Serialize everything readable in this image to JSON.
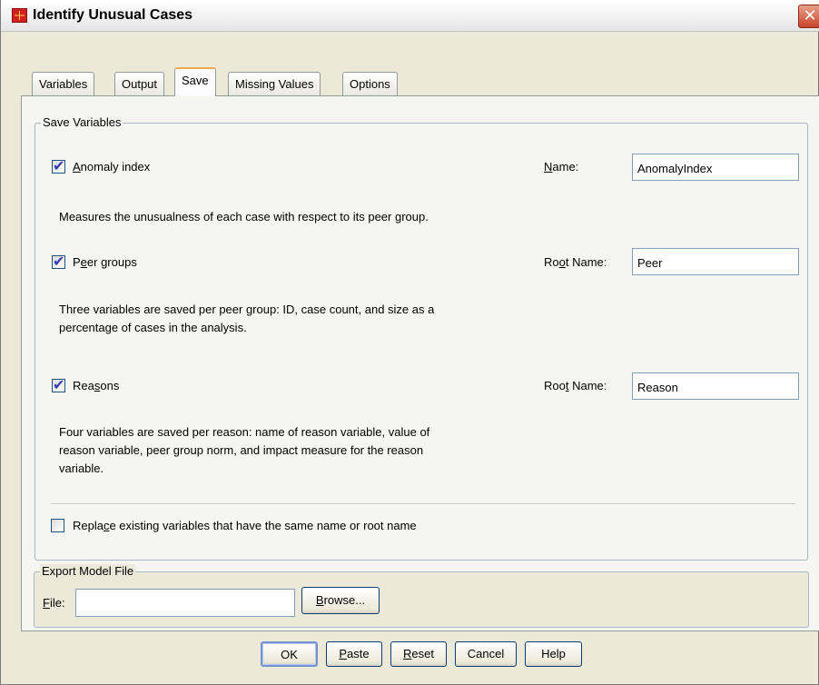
{
  "window": {
    "title": "Identify Unusual Cases",
    "close_glyph": "✕",
    "icon": "spss-data-editor-icon"
  },
  "tabs": [
    {
      "label": "Variables",
      "active": false
    },
    {
      "label": "Output",
      "active": false
    },
    {
      "label": "Save",
      "active": true
    },
    {
      "label": "Missing Values",
      "active": false
    },
    {
      "label": "Options",
      "active": false
    }
  ],
  "save_variables": {
    "legend": "Save Variables",
    "anomaly": {
      "pre": "",
      "mnemonic": "A",
      "post": "nomaly index",
      "checked": true,
      "field_label_pre": "",
      "field_label_mnemonic": "N",
      "field_label_post": "ame:",
      "value": "AnomalyIndex",
      "description": "Measures the unusualness of each case with respect to its peer group."
    },
    "peer": {
      "pre": "P",
      "mnemonic": "e",
      "post": "er groups",
      "checked": true,
      "field_label_pre": "Ro",
      "field_label_mnemonic": "o",
      "field_label_post": "t Name:",
      "value": "Peer",
      "description_line1": "Three variables are saved per peer group: ID, case count, and size as a",
      "description_line2": "percentage of cases in the analysis."
    },
    "reasons": {
      "pre": "Rea",
      "mnemonic": "s",
      "post": "ons",
      "checked": true,
      "field_label_pre": "Roo",
      "field_label_mnemonic": "t",
      "field_label_post": " Name:",
      "value": "Reason",
      "description_line1": "Four variables are saved per reason: name of reason variable, value of",
      "description_line2": "reason variable, peer group norm, and impact measure for the reason",
      "description_line3": "variable."
    },
    "replace": {
      "pre": "Repla",
      "mnemonic": "c",
      "post": "e existing variables that have the same name or root name",
      "checked": false
    }
  },
  "export": {
    "legend": "Export Model File",
    "file_label_mnemonic": "F",
    "file_label_post": "ile:",
    "file_value": "",
    "browse_mnemonic": "B",
    "browse_post": "rowse..."
  },
  "buttons": {
    "ok": "OK",
    "paste_mnemonic": "P",
    "paste_post": "aste",
    "reset_mnemonic": "R",
    "reset_post": "eset",
    "cancel": "Cancel",
    "help": "Help"
  },
  "colors": {
    "active_tab_accent": "#f3a84a",
    "checkmark": "#3a38b8",
    "close_button": "#c8432a"
  }
}
